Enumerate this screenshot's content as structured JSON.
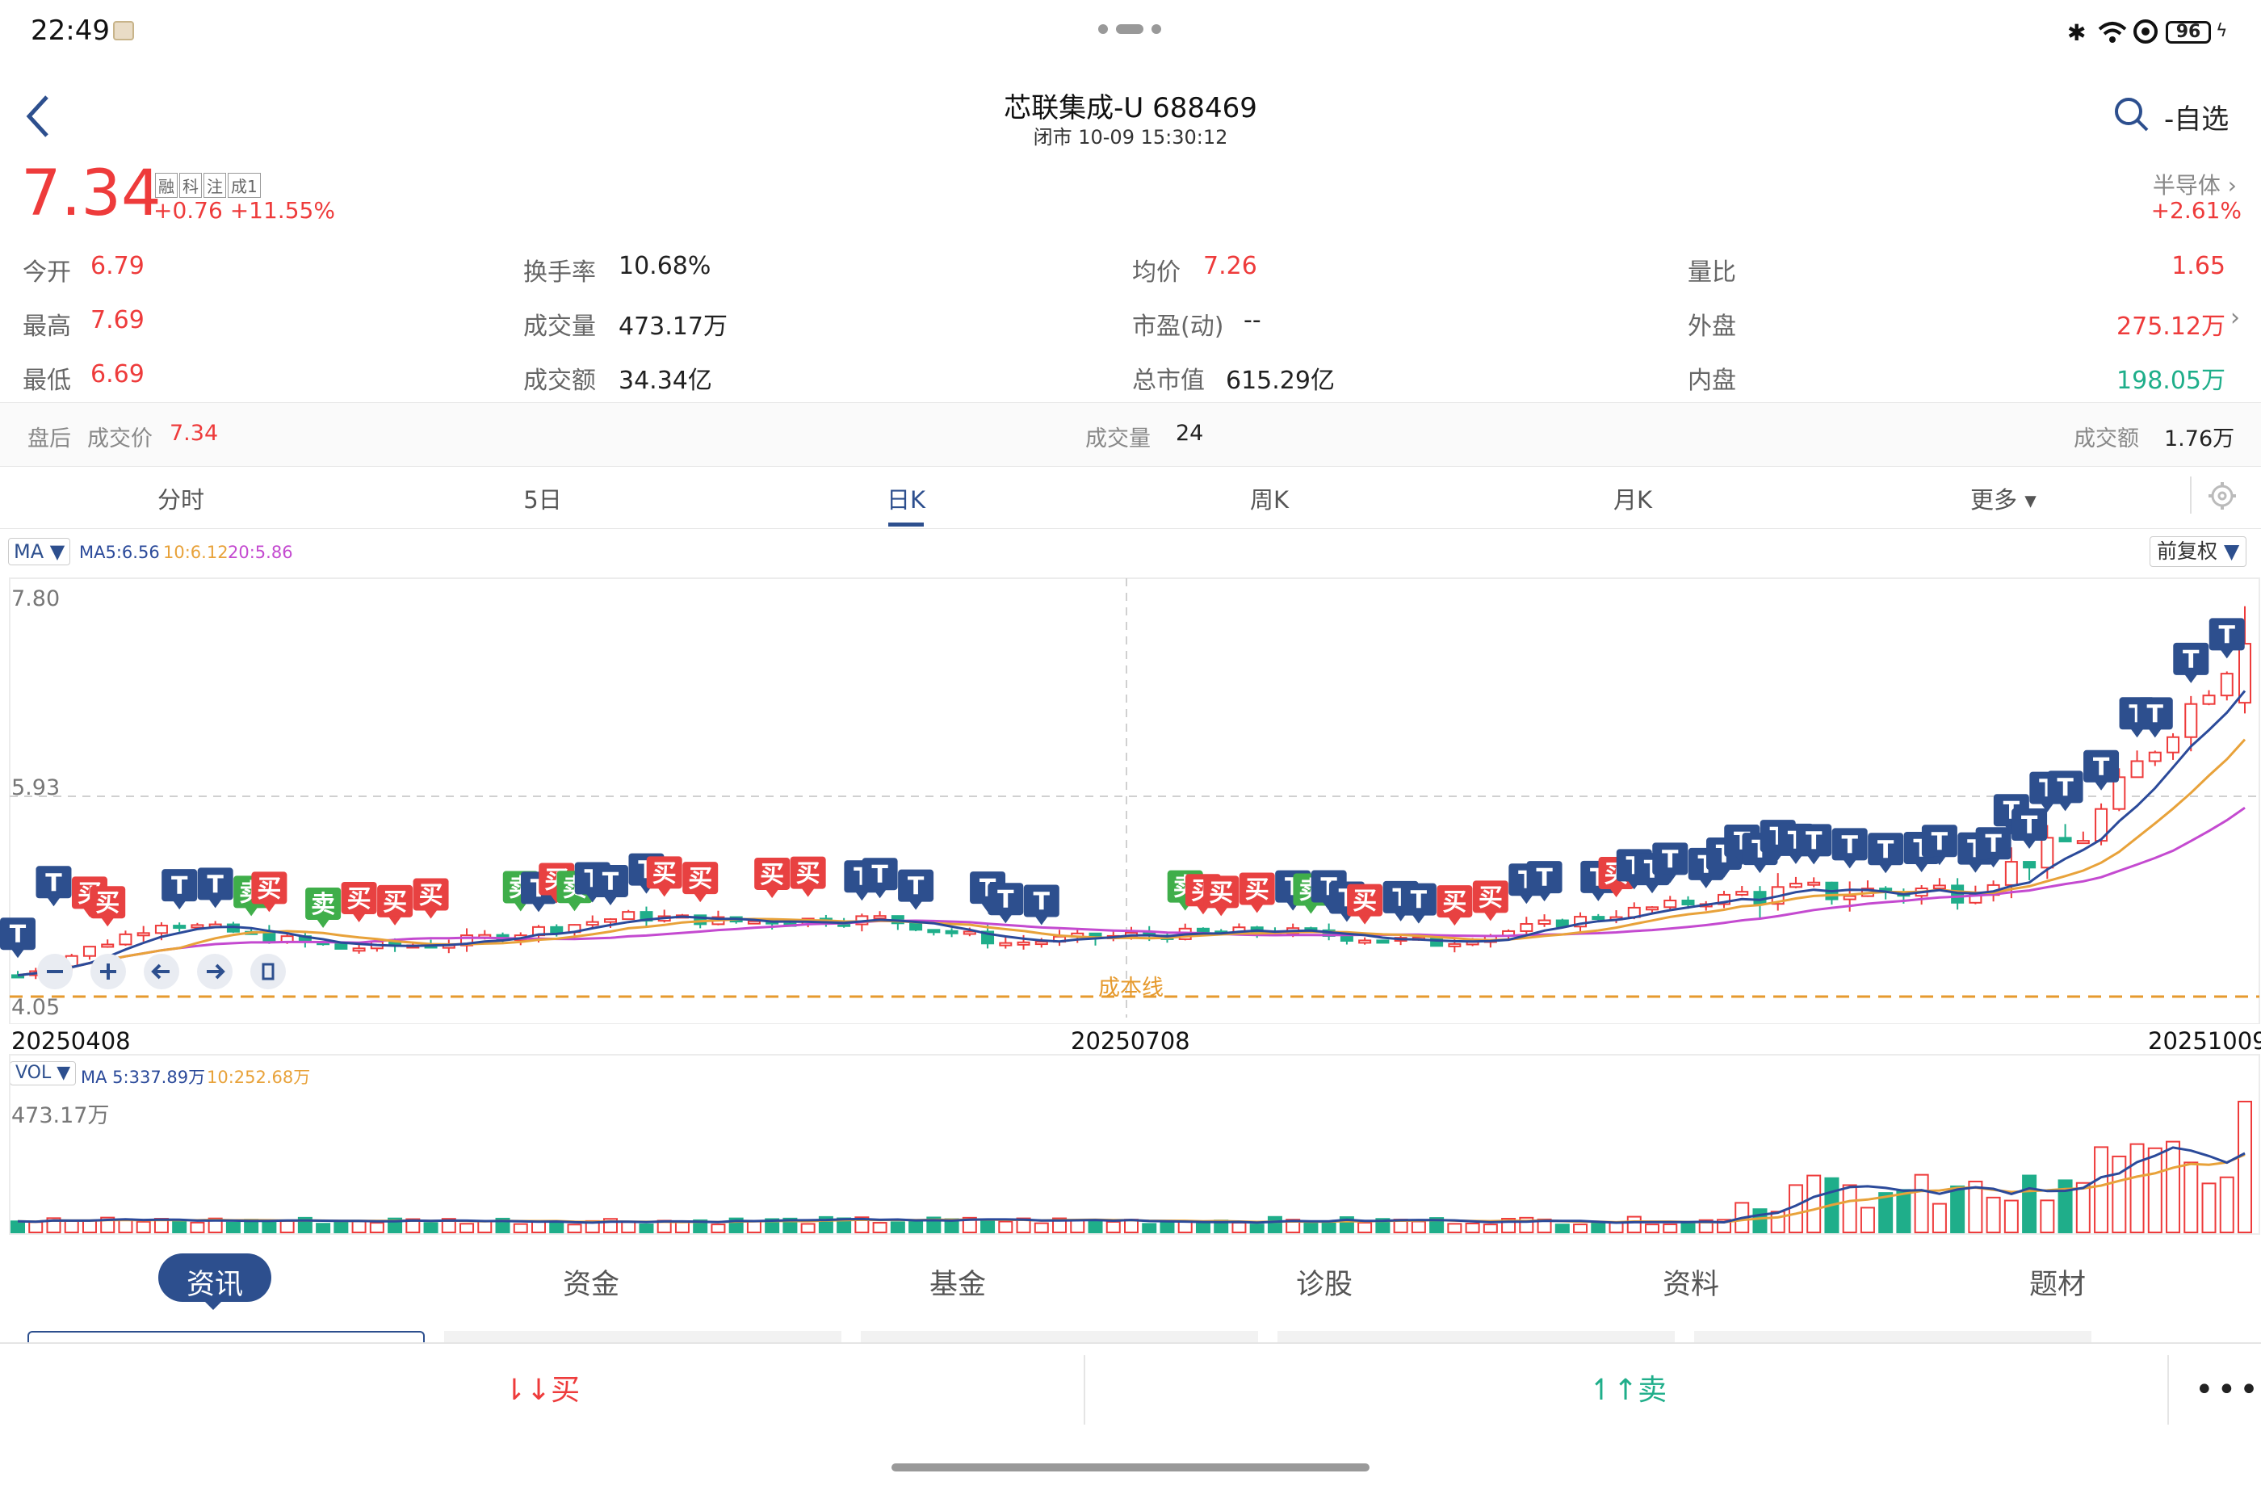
{
  "status": {
    "time": "22:49",
    "battery": "96"
  },
  "header": {
    "title": "芯联集成-U 688469",
    "subtitle": "闭市 10-09 15:30:12",
    "watch_label": "-自选"
  },
  "quote": {
    "price": "7.34",
    "change": "+0.76 +11.55%",
    "tags": [
      "融",
      "科",
      "注",
      "成1"
    ],
    "sector": "半导体",
    "sector_change": "+2.61%"
  },
  "stats": [
    [
      {
        "label": "今开",
        "value": "6.79"
      },
      {
        "label": "换手率",
        "value": "10.68%"
      },
      {
        "label": "均价",
        "value": "7.26"
      },
      {
        "label": "量比",
        "value": "1.65"
      }
    ],
    [
      {
        "label": "最高",
        "value": "7.69"
      },
      {
        "label": "成交量",
        "value": "473.17万"
      },
      {
        "label": "市盈(动)",
        "value": "--"
      },
      {
        "label": "外盘",
        "value": "275.12万"
      }
    ],
    [
      {
        "label": "最低",
        "value": "6.69"
      },
      {
        "label": "成交额",
        "value": "34.34亿"
      },
      {
        "label": "总市值",
        "value": "615.29亿"
      },
      {
        "label": "内盘",
        "value": "198.05万"
      }
    ]
  ],
  "afterhours": {
    "label": "盘后",
    "price_label": "成交价",
    "price": "7.34",
    "vol_label": "成交量",
    "vol": "24",
    "amt_label": "成交额",
    "amt": "1.76万"
  },
  "chart_tabs": [
    "分时",
    "5日",
    "日K",
    "周K",
    "月K",
    "更多"
  ],
  "ma": {
    "name": "MA",
    "ma5": "MA5:6.56",
    "ma10": "10:6.12",
    "ma20": "20:5.86"
  },
  "adjust": "前复权",
  "price_axis": {
    "top": "7.80",
    "mid": "5.93",
    "bottom": "4.05"
  },
  "cost_line": "成本线",
  "dates": {
    "start": "20250408",
    "mid": "20250708",
    "end": "20251009"
  },
  "vol": {
    "name": "VOL",
    "ma5": "MA 5:337.89万",
    "ma10": "10:252.68万",
    "max": "473.17万"
  },
  "signals": {
    "buy": "买",
    "sell": "卖",
    "t": "T"
  },
  "bottom_tabs": [
    "资讯",
    "资金",
    "基金",
    "诊股",
    "资料",
    "题材"
  ],
  "actions": {
    "buy": "买",
    "sell": "卖"
  },
  "colors": {
    "up": "#ee3b3b",
    "down": "#1fae8a",
    "accent": "#2d4f8e",
    "ma5": "#2b4a9a",
    "ma10": "#e8a23a",
    "ma20": "#c44ad0"
  }
}
